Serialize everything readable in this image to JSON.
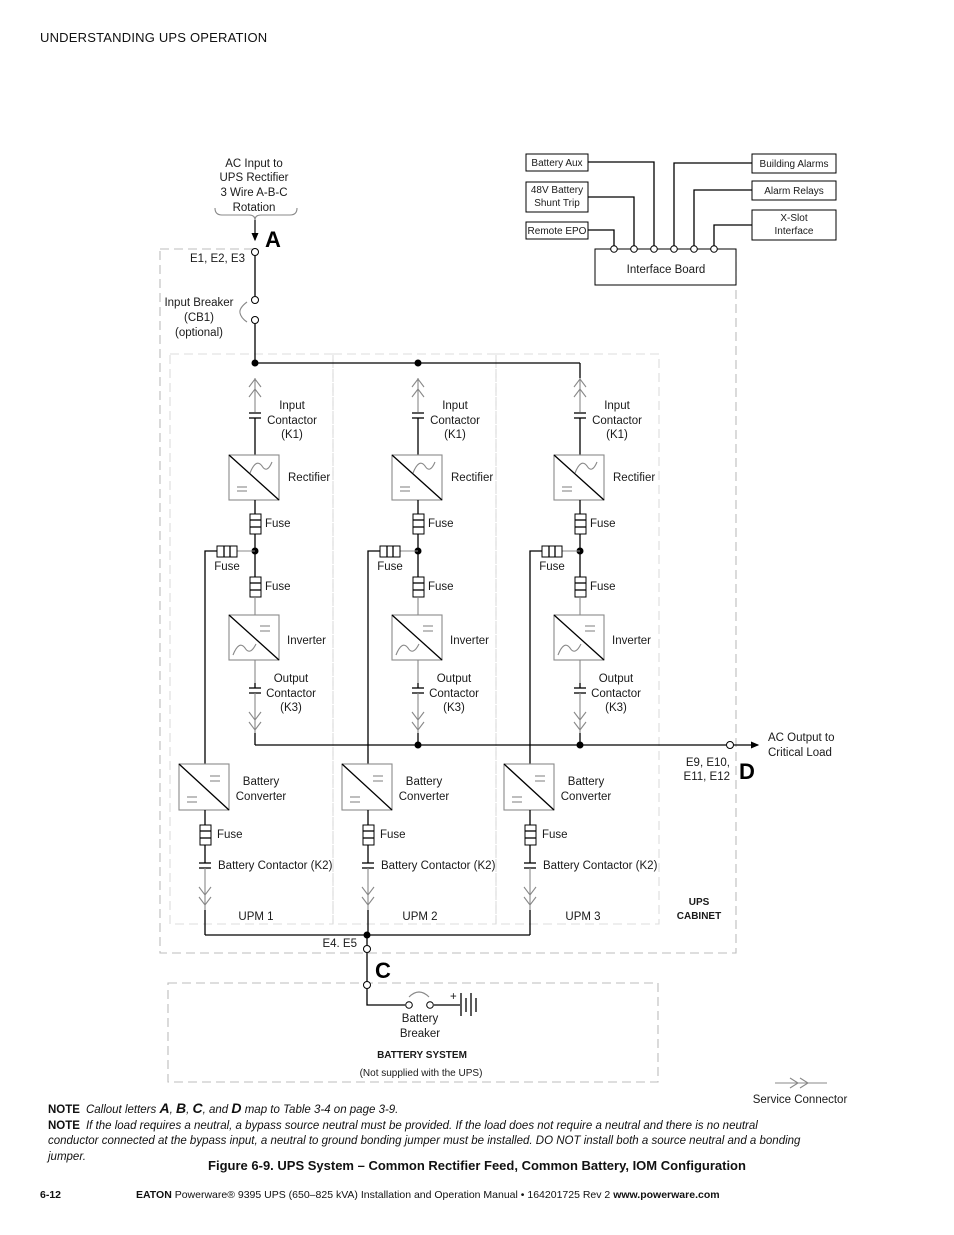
{
  "header": {
    "section": "UNDERSTANDING UPS OPERATION"
  },
  "diagram": {
    "ac_input": [
      "AC Input to",
      "UPS Rectifier",
      "3 Wire A-B-C",
      "Rotation"
    ],
    "callouts": {
      "a": "A",
      "c": "C",
      "d": "D"
    },
    "input_terminals": "E1, E2, E3",
    "input_breaker": [
      "Input Breaker",
      "(CB1)",
      "(optional)"
    ],
    "interface": {
      "board": "Interface Board",
      "left_boxes": [
        {
          "lines": [
            "Battery Aux"
          ]
        },
        {
          "lines": [
            "48V Battery",
            "Shunt Trip"
          ]
        },
        {
          "lines": [
            "Remote EPO"
          ]
        }
      ],
      "right_boxes": [
        {
          "lines": [
            "Building Alarms"
          ]
        },
        {
          "lines": [
            "Alarm Relays"
          ]
        },
        {
          "lines": [
            "X-Slot",
            "Interface"
          ]
        }
      ]
    },
    "upm_labels": {
      "input_contactor": [
        "Input",
        "Contactor",
        "(K1)"
      ],
      "rectifier": "Rectifier",
      "fuse": "Fuse",
      "inverter": "Inverter",
      "output_contactor": [
        "Output",
        "Contactor",
        "(K3)"
      ],
      "battery_converter": [
        "Battery",
        "Converter"
      ],
      "battery_contactor": "Battery Contactor (K2)"
    },
    "upms": [
      "UPM 1",
      "UPM 2",
      "UPM 3"
    ],
    "ups_cabinet": [
      "UPS",
      "CABINET"
    ],
    "ac_output": [
      "AC Output to",
      "Critical Load"
    ],
    "output_terminals": [
      "E9, E10,",
      "E11, E12"
    ],
    "battery_terminals": "E4. E5",
    "battery_breaker": [
      "Battery",
      "Breaker"
    ],
    "battery_system": "BATTERY SYSTEM",
    "battery_note": "(Not supplied with the UPS)",
    "battery_plus": "+",
    "service_connector": "Service Connector"
  },
  "notes": [
    {
      "label": "NOTE",
      "pre": "Callout letters ",
      "a": "A",
      "sep1": ", ",
      "b": "B",
      "sep2": ", ",
      "c": "C",
      "sep3": ", and ",
      "d": "D",
      "post": " map to Table 3-4 on page 3-9."
    },
    {
      "label": "NOTE",
      "text": "If the load requires a neutral, a bypass source neutral must be provided. If the load does not require a neutral and there is no neutral conductor connected at the bypass input, a neutral to ground bonding jumper must be installed. DO NOT install both a source neutral and a bonding jumper."
    }
  ],
  "figure_caption": "Figure 6-9. UPS System – Common Rectifier Feed, Common Battery, IOM Configuration",
  "footer": {
    "page": "6-12",
    "brand": "EATON",
    "text": " Powerware® 9395 UPS (650–825 kVA) Installation and Operation Manual  •  164201725 Rev 2 ",
    "url": "www.powerware.com"
  }
}
